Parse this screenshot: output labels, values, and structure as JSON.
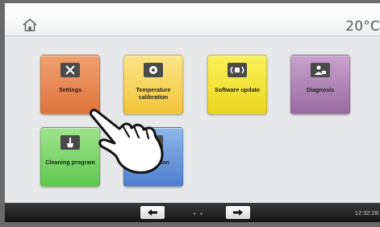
{
  "header": {
    "temperature": "20°C"
  },
  "tiles": [
    {
      "label": "Settings",
      "icon": "tools-icon"
    },
    {
      "label": "Temperature calibration",
      "icon": "calibration-disc-icon"
    },
    {
      "label": "Software update",
      "icon": "software-chip-icon"
    },
    {
      "label": "Diagnosis",
      "icon": "diagnosis-icon"
    },
    {
      "label": "Cleaning program",
      "icon": "cleaning-icon"
    },
    {
      "label": "Information",
      "icon": "information-icon"
    }
  ],
  "footer": {
    "time": "12:32:28",
    "page_indicator": "• •"
  },
  "colors": {
    "settings": "#e0743c",
    "calibration": "#f2c537",
    "software": "#ead61e",
    "diagnosis": "#9a6aa3",
    "cleaning": "#5ec84e",
    "information": "#4d7fd0"
  }
}
